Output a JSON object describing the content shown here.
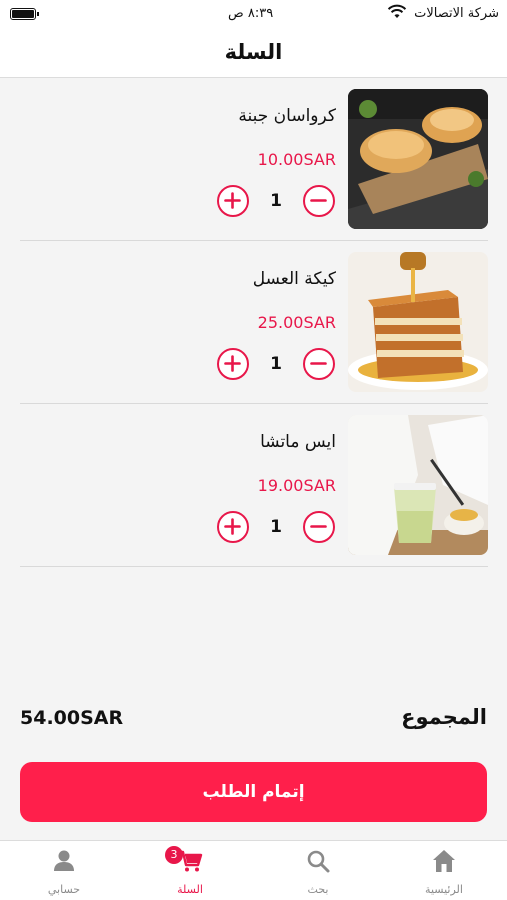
{
  "status_bar": {
    "carrier": "شركة الاتصالات",
    "time": "٨:٣٩ ص"
  },
  "header": {
    "title": "السلة"
  },
  "cart": {
    "items": [
      {
        "name": "كرواسان جبنة",
        "price": "10.00SAR",
        "quantity": "1"
      },
      {
        "name": "كيكة العسل",
        "price": "25.00SAR",
        "quantity": "1"
      },
      {
        "name": "ايس ماتشا",
        "price": "19.00SAR",
        "quantity": "1"
      }
    ]
  },
  "total": {
    "label": "المجموع",
    "value": "54.00SAR"
  },
  "checkout": {
    "label": "إتمام الطلب"
  },
  "tabs": {
    "home": "الرئيسية",
    "search": "بحث",
    "cart": "السلة",
    "cart_badge": "3",
    "account": "حسابي"
  },
  "colors": {
    "accent": "#e8174a",
    "checkout_button": "#ff1f4b",
    "inactive_tab": "#8a8a8a"
  }
}
